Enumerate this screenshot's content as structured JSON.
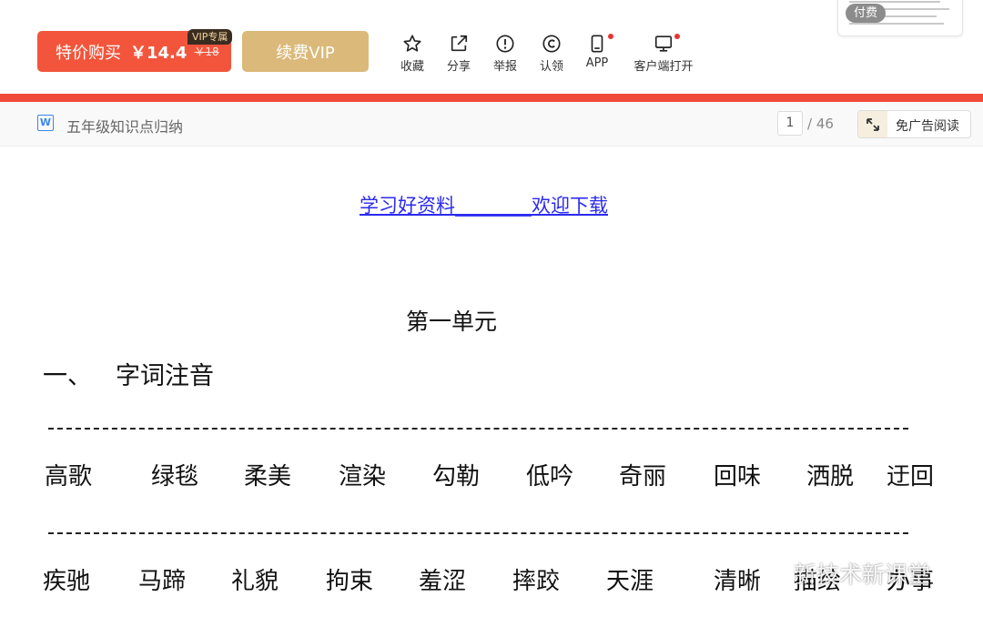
{
  "toolbar": {
    "buy_label": "特价购买",
    "buy_price": "￥14.4",
    "buy_old_price": "￥18",
    "vip_tag": "VIP专属",
    "renew_label": "续费VIP",
    "tools": {
      "favorite": "收藏",
      "share": "分享",
      "report": "举报",
      "claim": "认领",
      "app": "APP",
      "client": "客户端打开"
    },
    "pay_badge": "付费"
  },
  "doc_header": {
    "icon_letter": "W",
    "title": "五年级知识点归纳",
    "current_page": "1",
    "total_pages": "/ 46",
    "no_ad_label": "免广告阅读"
  },
  "content": {
    "link_text": "学习好资料________欢迎下载",
    "unit_title": "第一单元",
    "section_number": "一、",
    "section_title": "字词注音",
    "row1": [
      "高歌",
      "绿毯",
      "柔美",
      "渲染",
      "勾勒",
      "低吟",
      "奇丽",
      "回味",
      "洒脱",
      "迂回"
    ],
    "row2": [
      "疾驰",
      "马蹄",
      "礼貌",
      "拘束",
      "羞涩",
      "摔跤",
      "天涯",
      "清晰",
      "描绘",
      "办事"
    ]
  },
  "watermark": "新技术新课堂",
  "colors": {
    "buy_button": "#f2553b",
    "renew_button": "#dab97a",
    "accent_bar": "#f04b3a",
    "link": "#2a2af0"
  }
}
